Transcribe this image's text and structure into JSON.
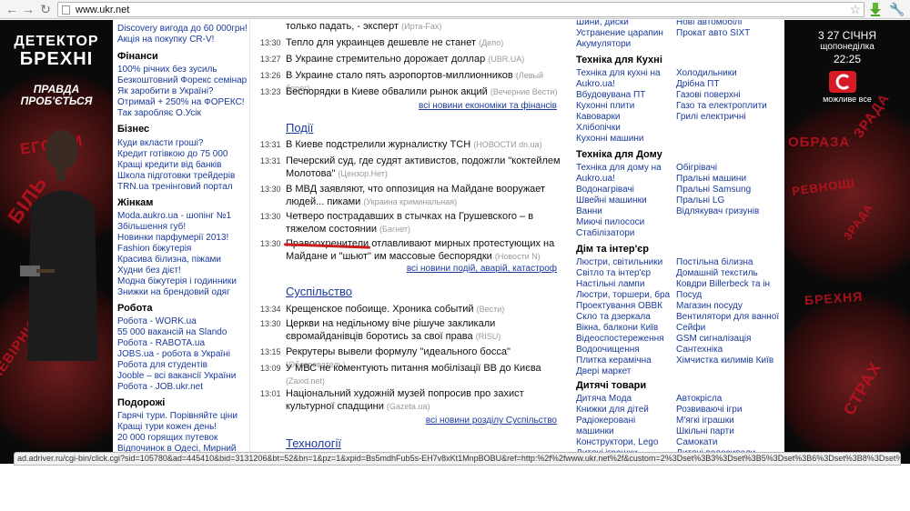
{
  "browser": {
    "url": "www.ukr.net"
  },
  "left_banner": {
    "logo_line1": "ДЕТЕКТОР",
    "logo_line2": "БРЕХНІ",
    "tagline1": "ПРАВДА",
    "tagline2": "ПРОБ'ЄТЬСЯ",
    "words": [
      "ЕГОЇЗМ",
      "БІЛЬ",
      "НЕВІРНІСТЬ"
    ]
  },
  "right_banner": {
    "date_line": "3 27 СІЧНЯ",
    "weekday": "щопонеділка",
    "time": "22:25",
    "channel_tagline": "можливе все",
    "words": [
      "ЗРАДА",
      "ОБРАЗА",
      "РЕВНОЩІ",
      "ЗРАДА",
      "БРЕХНЯ",
      "СТРАХ"
    ],
    "accent": "#c1121f"
  },
  "left_col": {
    "top_links": [
      "Discovery вигода до 60 000грн!",
      "Акція на покупку CR-V!"
    ],
    "sections": [
      {
        "title": "Фінанси",
        "links": [
          "100% річних без зусиль",
          "Безкоштовний Форекс семінар",
          "Як заробити в Україні?",
          "Отримай + 250% на ФОРЕКС!",
          "Так заробляє О.Усік"
        ]
      },
      {
        "title": "Бізнес",
        "links": [
          "Куди вкласти гроші?",
          "Кредит готівкою до 75 000",
          "Кращі кредити від банків",
          "Школа підготовки трейдерів",
          "TRN.ua тренінговий портал"
        ]
      },
      {
        "title": "Жінкам",
        "links": [
          "Moda.aukro.ua - шопінг №1",
          "Збільшення губ!",
          "Новинки парфумерії 2013!",
          "Fashion біжутерія",
          "Красива білизна, піжами",
          "Худни без дієт!",
          "Модна біжутерія і годинники",
          "Знижки на брендовий одяг"
        ]
      },
      {
        "title": "Робота",
        "links": [
          "Робота - WORK.ua",
          "55 000 вакансій на Slando",
          "Робота - RABOTA.ua",
          "JOBS.ua - робота в Україні",
          "Робота для студентів",
          "Jooble – всі вакансії України",
          "Робота - JOB.ukr.net"
        ]
      },
      {
        "title": "Подорожі",
        "links": [
          "Гарячі тури. Порівняйте ціни",
          "Кращі тури кожен день!",
          "20 000 горящих путевок",
          "Відпочинок в Одесі, Мирний"
        ]
      }
    ]
  },
  "news": {
    "top_items": [
      {
        "time": "",
        "text": "только падать, - эксперт",
        "source": "(Ирта-Fax)"
      },
      {
        "time": "13:30",
        "text": "Тепло для украинцев дешевле не станет",
        "source": "(Дело)"
      },
      {
        "time": "13:27",
        "text": "В Украине стремительно дорожает доллар",
        "source": "(UBR.UA)"
      },
      {
        "time": "13:26",
        "text": "В Украине стало пять аэропортов-миллионников",
        "source": "(Левый берег)"
      },
      {
        "time": "13:23",
        "text": "Беспорядки в Киеве обвалили рынок акций",
        "source": "(Вечерние Вести)"
      }
    ],
    "top_all_link": "всі новини економіки та фінансів",
    "sections": [
      {
        "title": "Події",
        "items": [
          {
            "time": "13:31",
            "text": "В Киеве подстрелили журналистку ТСН",
            "source": "(НОВОСТИ dn.ua)"
          },
          {
            "time": "13:31",
            "text": "Печерский суд, где судят активистов, подожгли \"коктейлем Молотова\"",
            "source": "(Цензор.Нет)"
          },
          {
            "time": "13:30",
            "text": "В МВД заявляют, что оппозиция на Майдане вооружает людей... пиками",
            "source": "(Украина криминальная)"
          },
          {
            "time": "13:30",
            "text": "Четверо пострадавших в стычках на Грушевского – в тяжелом состоянии",
            "source": "(Багнет)"
          },
          {
            "time": "13:30",
            "text": "Правоохренители отлавливают мирных протестующих на Майдане и \"шьют\" им массовые беспорядки",
            "source": "(Новости N)"
          }
        ],
        "all_link": "всі новини подій, аварій, катастроф"
      },
      {
        "title": "Суспільство",
        "items": [
          {
            "time": "13:34",
            "text": "Крещенское побоище. Хроника событий",
            "source": "(Вести)"
          },
          {
            "time": "13:30",
            "text": "Церкви на недільному віче рішуче закликали євромайданівців боротись за свої права",
            "source": "(RISU)"
          },
          {
            "time": "13:15",
            "text": "Рекрутеры вывели формулу \"идеального босса\"",
            "source": "(Обозреватель)"
          },
          {
            "time": "13:09",
            "text": "У МВС не коментують питання мобілізації ВВ до Києва",
            "source": "(Zaxid.net)"
          },
          {
            "time": "13:01",
            "text": "Національний художній музей попросив про захист культурної спадщини",
            "source": "(Gazeta.ua)"
          }
        ],
        "all_link": "всі новини розділу Суспільство"
      },
      {
        "title": "Технології",
        "items": [],
        "all_link": ""
      }
    ]
  },
  "shop": {
    "top_left": [
      "Шини, диски",
      "Устранение царапин",
      "Акумулятори"
    ],
    "top_right": [
      "Нові автомобілі",
      "Прокат авто SIXT"
    ],
    "sections": [
      {
        "title": "Техніка для Кухні",
        "left": [
          "Техніка для кухні на",
          "Aukro.ua!",
          "Вбудовувана ПТ",
          "Кухонні плити",
          "Кавоварки",
          "Хлібопічки",
          "Кухонні машини"
        ],
        "right": [
          "Холодильники",
          "Дрібна ПТ",
          "Газові поверхні",
          "Газо та електроплити",
          "Грилі електричні"
        ]
      },
      {
        "title": "Техніка для Дому",
        "left": [
          "Техніка для дому на",
          "Aukro.ua!",
          "Водонагрівачі",
          "Швейні машинки",
          "Ванни",
          "Миючі пилососи",
          "Стабілізатори"
        ],
        "right": [
          "Обігрівачі",
          "Пральні машини",
          "Пральні Samsung",
          "Пральні LG",
          "Відлякувач гризунів"
        ]
      },
      {
        "title": "Дім та інтер'єр",
        "left": [
          "Люстри, світильники",
          "Світло та інтер'єр",
          "Настільні лампи",
          "Люстри, торшери, бра",
          "Проектування ОВВК",
          "Скло та дзеркала",
          "Вікна, балкони Київ",
          "Відеоспостереження",
          "Водоочищення",
          "Плитка керамічна",
          "Двері маркет"
        ],
        "right": [
          "Постільна білизна",
          "Домашній текстиль",
          "Ковдри Billerbeck та ін",
          "Посуд",
          "Магазин посуду",
          "Вентилятори для ванної",
          "Сейфи",
          "GSM сигналізація",
          "Сантехніка",
          "Хімчистка килимів Київ"
        ]
      },
      {
        "title": "Дитячі товари",
        "left": [
          "Дитяча Мода",
          "Книжки для дітей",
          "Радіокеровані",
          "машинки",
          "Конструктори, Lego",
          "Дитячі іграшки"
        ],
        "right": [
          "Автокрісла",
          "Розвиваючі ігри",
          "М'ягкі іграшки",
          "Шкільні парти",
          "Самокати",
          "Дитячі велосипеди"
        ]
      }
    ]
  },
  "status": {
    "text": "ad.adriver.ru/cgi-bin/click.cgi?sid=105780&ad=445410&bid=3131206&bt=52&bn=1&pz=1&xpid=Bs5mdhFub5s-EH7v8xKt1MnpBOBU&ref=http:%2f%2fwww.ukr.net%2f&custom=2%3Dset%3B3%3Dset%3B5%3Dset%3B6%3Dset%3B8%3Dset%3B12%3..."
  }
}
